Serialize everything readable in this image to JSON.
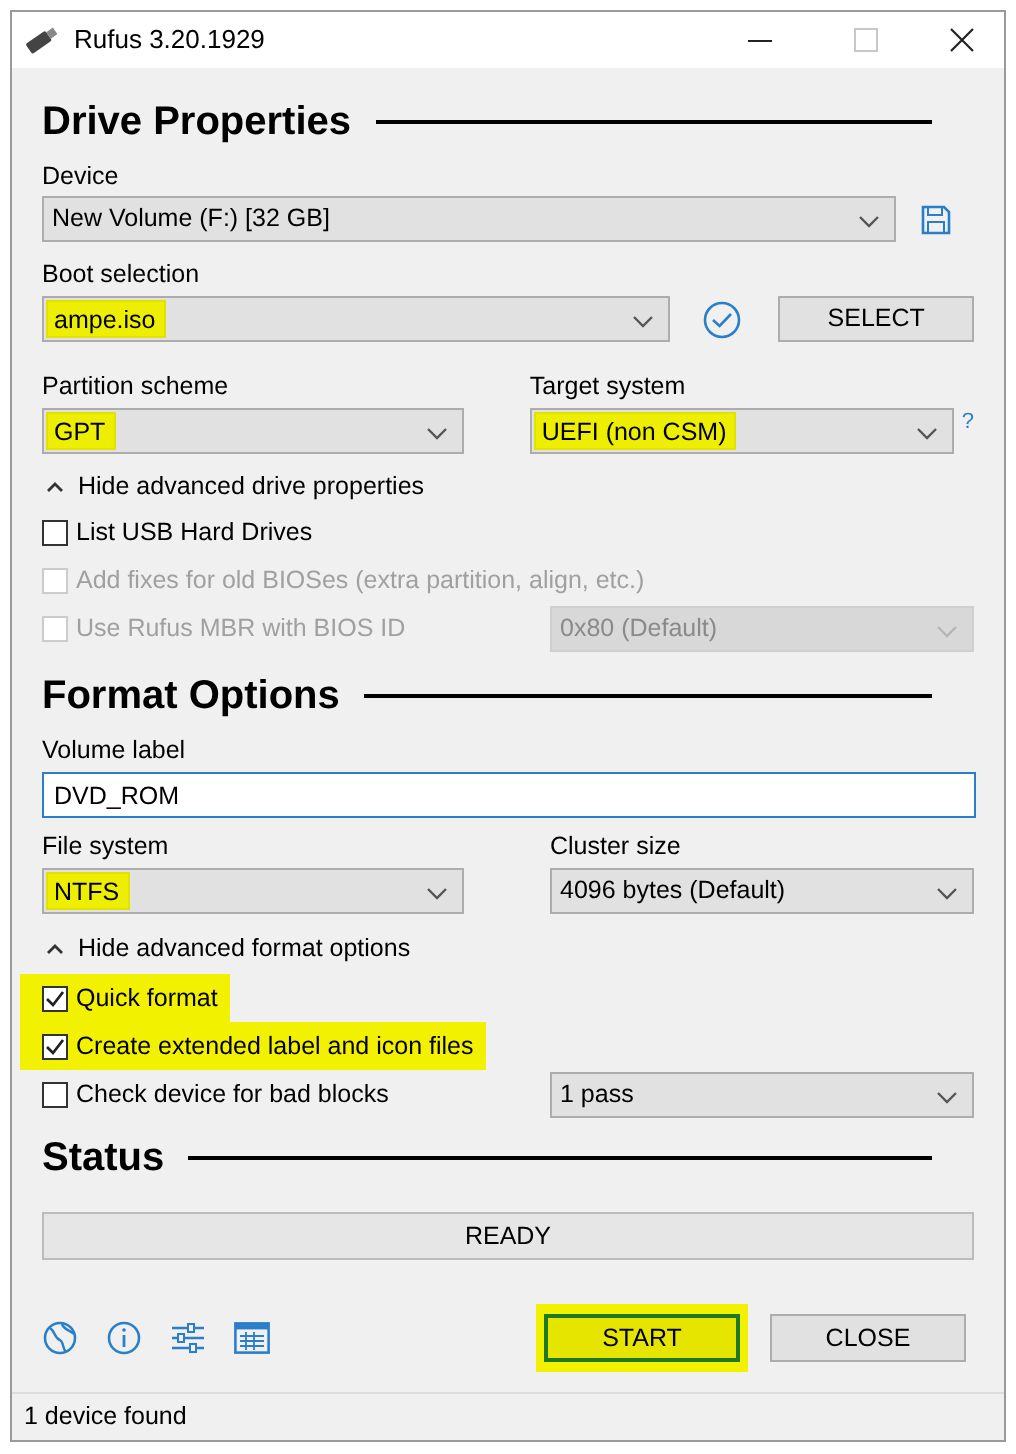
{
  "window": {
    "title": "Rufus 3.20.1929"
  },
  "drive_properties": {
    "heading": "Drive Properties",
    "device": {
      "label": "Device",
      "value": "New Volume (F:) [32 GB]",
      "highlighted": false
    },
    "boot_selection": {
      "label": "Boot selection",
      "value": "ampe.iso",
      "highlighted": true
    },
    "select_button": "SELECT",
    "partition_scheme": {
      "label": "Partition scheme",
      "value": "GPT",
      "highlighted": true
    },
    "target_system": {
      "label": "Target system",
      "value": "UEFI (non CSM)",
      "highlighted": true
    },
    "help_mark": "?",
    "toggle": "Hide advanced drive properties",
    "options": [
      {
        "label": "List USB Hard Drives",
        "checked": false,
        "disabled": false,
        "highlighted": false
      },
      {
        "label": "Add fixes for old BIOSes (extra partition, align, etc.)",
        "checked": false,
        "disabled": true,
        "highlighted": false
      },
      {
        "label": "Use Rufus MBR with BIOS ID",
        "checked": false,
        "disabled": true,
        "highlighted": false,
        "dropdown": {
          "value": "0x80 (Default)",
          "disabled": true
        }
      }
    ]
  },
  "format_options": {
    "heading": "Format Options",
    "volume_label": {
      "label": "Volume label",
      "value": "DVD_ROM"
    },
    "file_system": {
      "label": "File system",
      "value": "NTFS",
      "highlighted": true
    },
    "cluster_size": {
      "label": "Cluster size",
      "value": "4096 bytes (Default)",
      "highlighted": false
    },
    "toggle": "Hide advanced format options",
    "options": [
      {
        "label": "Quick format",
        "checked": true,
        "disabled": false,
        "highlighted": true
      },
      {
        "label": "Create extended label and icon files",
        "checked": true,
        "disabled": false,
        "highlighted": true
      },
      {
        "label": "Check device for bad blocks",
        "checked": false,
        "disabled": false,
        "highlighted": false,
        "dropdown": {
          "value": "1 pass",
          "disabled": false
        }
      }
    ]
  },
  "status": {
    "heading": "Status",
    "progress": {
      "text": "READY"
    }
  },
  "buttons": [
    {
      "label": "START",
      "highlighted": true
    },
    {
      "label": "CLOSE",
      "highlighted": false
    }
  ],
  "status_bar": "1 device found"
}
